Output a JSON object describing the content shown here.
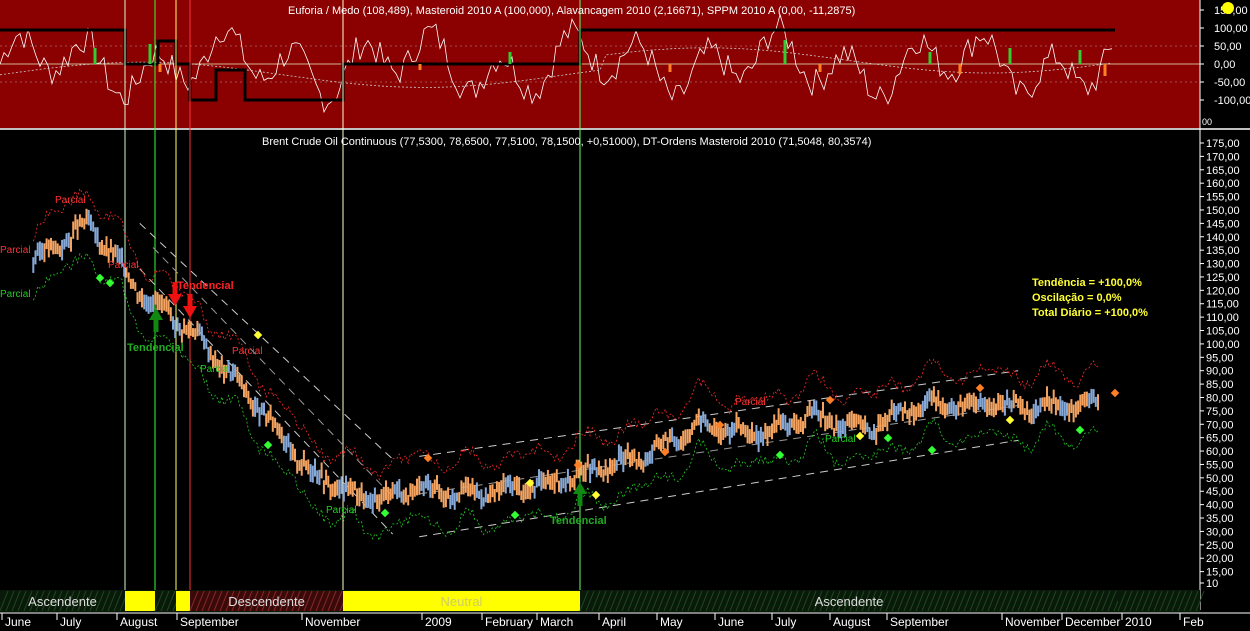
{
  "window": {
    "close_icon": "close-icon"
  },
  "indicator": {
    "title": "Euforia / Medo (108,489), Masteroid 2010 A (100,000), Alavancagem 2010 (2,16671), SPPM 2010 A (0,00, -11,2875)",
    "background": "#8b0000",
    "y_ticks": [
      "150,00",
      "100,00",
      "50,00",
      "0,00",
      "-50,00",
      "-100,00"
    ],
    "corner_label": "00"
  },
  "main": {
    "title": "Brent Crude Oil Continuous (77,5300, 78,6500, 77,5100, 78,1500, +0,51000), DT-Ordens Masteroid 2010 (71,5048, 80,3574)",
    "y_ticks": [
      "175,00",
      "170,00",
      "165,00",
      "160,00",
      "155,00",
      "150,00",
      "145,00",
      "140,00",
      "135,00",
      "130,00",
      "125,00",
      "120,00",
      "115,00",
      "110,00",
      "105,00",
      "100,00",
      "95,00",
      "90,00",
      "85,00",
      "80,00",
      "75,00",
      "70,00",
      "65,00",
      "60,00",
      "55,00",
      "50,00",
      "45,00",
      "40,00",
      "35,00",
      "30,00",
      "25,00",
      "20,00",
      "15,00",
      "10"
    ],
    "summary": [
      "Tendência = +100,0%",
      "Oscilação = 0,0%",
      "Total Diário = +100,0%"
    ],
    "annotations": {
      "parcial": "Parcial",
      "tendencial": "Tendencial"
    }
  },
  "regime_bar": {
    "segments": [
      {
        "label": "Ascendente",
        "type": "asc"
      },
      {
        "label": "",
        "type": "yellow"
      },
      {
        "label": "",
        "type": "asc"
      },
      {
        "label": "",
        "type": "yellow"
      },
      {
        "label": "Descendente",
        "type": "desc"
      },
      {
        "label": "Neutral",
        "type": "neutral"
      },
      {
        "label": "Ascendente",
        "type": "asc"
      }
    ]
  },
  "x_axis": {
    "labels": [
      "June",
      "July",
      "August",
      "September",
      "November",
      "2009",
      "February",
      "March",
      "April",
      "May",
      "June",
      "July",
      "August",
      "September",
      "November",
      "December",
      "2010",
      "Feb"
    ]
  },
  "chart_data": {
    "type": "line",
    "title": "Brent Crude Oil Continuous (77,5300, 78,6500, 77,5100, 78,1500, +0,51000), DT-Ordens Masteroid 2010 (71,5048, 80,3574)",
    "ylim": [
      10,
      175
    ],
    "x": [
      "2008-06",
      "2008-07",
      "2008-08",
      "2008-09",
      "2008-10",
      "2008-11",
      "2008-12",
      "2009-01",
      "2009-02",
      "2009-03",
      "2009-04",
      "2009-05",
      "2009-06",
      "2009-07",
      "2009-08",
      "2009-09",
      "2009-10",
      "2009-11",
      "2009-12",
      "2010-01"
    ],
    "series": [
      {
        "name": "Brent Crude Oil Continuous",
        "color": "#f4a460",
        "values": [
          131,
          145,
          118,
          102,
          78,
          52,
          42,
          46,
          44,
          47,
          52,
          58,
          70,
          66,
          73,
          68,
          77,
          78,
          76,
          78
        ]
      }
    ],
    "channel": {
      "descending_upper": [
        [
          2008.58,
          145
        ],
        [
          2008.96,
          57
        ]
      ],
      "descending_lower": [
        [
          2008.58,
          128
        ],
        [
          2008.96,
          29
        ]
      ],
      "ascending_upper": [
        [
          2009.0,
          58
        ],
        [
          2009.9,
          90
        ]
      ],
      "ascending_lower": [
        [
          2009.0,
          28
        ],
        [
          2009.9,
          64
        ]
      ]
    },
    "indicator": {
      "name": "Euforia / Medo",
      "ylim": [
        -150,
        150
      ],
      "masteroid_steps": [
        [
          2008.42,
          100
        ],
        [
          2008.63,
          60
        ],
        [
          2008.7,
          -100
        ],
        [
          2008.97,
          100
        ],
        [
          2009.9,
          100
        ]
      ]
    }
  }
}
